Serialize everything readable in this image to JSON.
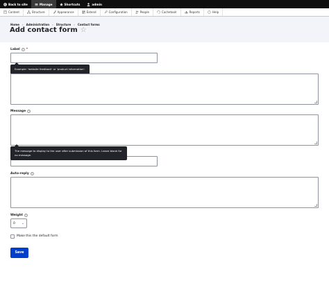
{
  "toolbar": {
    "back": "Back to site",
    "manage": "Manage",
    "shortcuts": "Shortcuts",
    "user": "admin"
  },
  "tray": {
    "items": [
      "Content",
      "Structure",
      "Appearance",
      "Extend",
      "Configuration",
      "People",
      "Cachetoolr",
      "Reports",
      "Help"
    ]
  },
  "breadcrumb": [
    "Home",
    "Administration",
    "Structure",
    "Contact forms"
  ],
  "breadcrumb_sep": "›",
  "page": {
    "title": "Add contact form",
    "star": "☆"
  },
  "form": {
    "label_field": {
      "label": "Label",
      "required": "*",
      "help": "?",
      "value": ""
    },
    "label_tooltip": "Example: 'website feedback' or 'product information'.",
    "message_field": {
      "label": "Message",
      "help": "?"
    },
    "message_tooltip": "The message to display to the user after submission of this form. Leave blank for no message.",
    "autoreply_field": {
      "label": "Auto-reply",
      "help": "?"
    },
    "weight_field": {
      "label": "Weight",
      "help": "?",
      "value": "0",
      "arrow": "⌄"
    },
    "default_checkbox": {
      "label": "Make this the default form",
      "checked": false
    },
    "save_label": "Save"
  }
}
